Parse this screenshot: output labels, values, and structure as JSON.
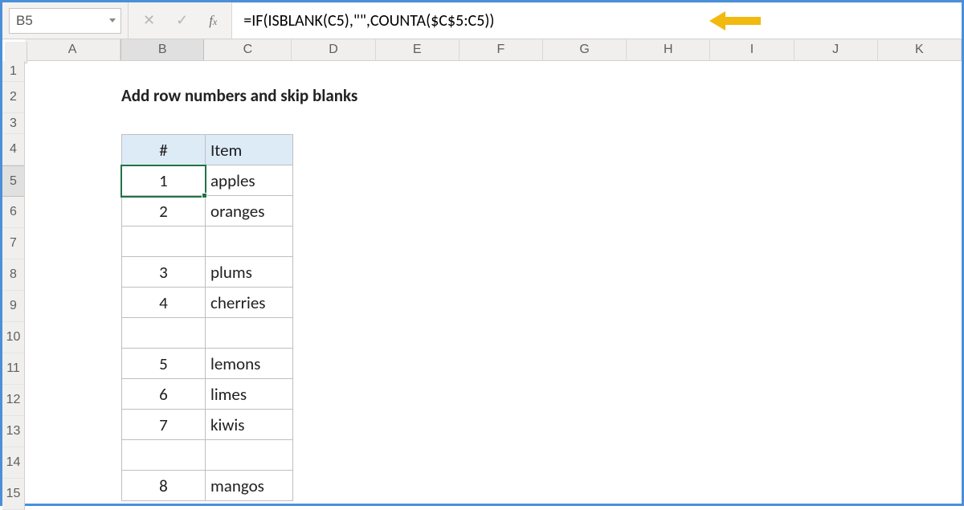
{
  "namebox": {
    "value": "B5"
  },
  "formula": {
    "value": "=IF(ISBLANK(C5),\"\",COUNTA($C$5:C5))"
  },
  "columns": [
    "A",
    "B",
    "C",
    "D",
    "E",
    "F",
    "G",
    "H",
    "I",
    "J",
    "K"
  ],
  "rows": [
    "1",
    "2",
    "3",
    "4",
    "5",
    "6",
    "7",
    "8",
    "9",
    "10",
    "11",
    "12",
    "13",
    "14",
    "15"
  ],
  "active": {
    "row": "5",
    "col": "B"
  },
  "title": "Add row numbers and skip blanks",
  "table": {
    "headers": {
      "num": "#",
      "item": "Item"
    },
    "rows": [
      {
        "num": "1",
        "item": "apples"
      },
      {
        "num": "2",
        "item": "oranges"
      },
      {
        "num": "",
        "item": ""
      },
      {
        "num": "3",
        "item": "plums"
      },
      {
        "num": "4",
        "item": "cherries"
      },
      {
        "num": "",
        "item": ""
      },
      {
        "num": "5",
        "item": "lemons"
      },
      {
        "num": "6",
        "item": "limes"
      },
      {
        "num": "7",
        "item": "kiwis"
      },
      {
        "num": "",
        "item": ""
      },
      {
        "num": "8",
        "item": "mangos"
      }
    ]
  },
  "arrow_color": "#f2b90f"
}
